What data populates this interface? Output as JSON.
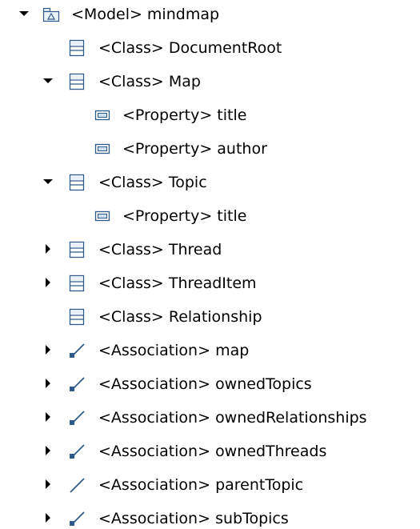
{
  "tree": {
    "nodes": [
      {
        "label": "<Model> mindmap",
        "icon": "package-icon",
        "expander": "expanded",
        "level": 0
      },
      {
        "label": "<Class> DocumentRoot",
        "icon": "class-icon",
        "expander": "none",
        "level": 1
      },
      {
        "label": "<Class> Map",
        "icon": "class-icon",
        "expander": "expanded",
        "level": 1
      },
      {
        "label": "<Property> title",
        "icon": "property-icon",
        "expander": "none",
        "level": 2
      },
      {
        "label": "<Property> author",
        "icon": "property-icon",
        "expander": "none",
        "level": 2
      },
      {
        "label": "<Class> Topic",
        "icon": "class-icon",
        "expander": "expanded",
        "level": 1
      },
      {
        "label": "<Property> title",
        "icon": "property-icon",
        "expander": "none",
        "level": 2
      },
      {
        "label": "<Class> Thread",
        "icon": "class-icon",
        "expander": "collapsed",
        "level": 1
      },
      {
        "label": "<Class> ThreadItem",
        "icon": "class-icon",
        "expander": "collapsed",
        "level": 1
      },
      {
        "label": "<Class> Relationship",
        "icon": "class-icon",
        "expander": "none",
        "level": 1
      },
      {
        "label": "<Association> map",
        "icon": "association-icon",
        "expander": "collapsed",
        "level": 1
      },
      {
        "label": "<Association> ownedTopics",
        "icon": "association-icon",
        "expander": "collapsed",
        "level": 1
      },
      {
        "label": "<Association> ownedRelationships",
        "icon": "association-icon",
        "expander": "collapsed",
        "level": 1
      },
      {
        "label": "<Association> ownedThreads",
        "icon": "association-icon",
        "expander": "collapsed",
        "level": 1
      },
      {
        "label": "<Association> parentTopic",
        "icon": "association-plain-icon",
        "expander": "collapsed",
        "level": 1
      },
      {
        "label": "<Association> subTopics",
        "icon": "association-icon",
        "expander": "collapsed",
        "level": 1
      }
    ]
  },
  "colors": {
    "icon_stroke": "#2f5a8c",
    "icon_fill": "#eaf1f9",
    "property_fill": "#cfe0f2",
    "expander": "#000000"
  }
}
